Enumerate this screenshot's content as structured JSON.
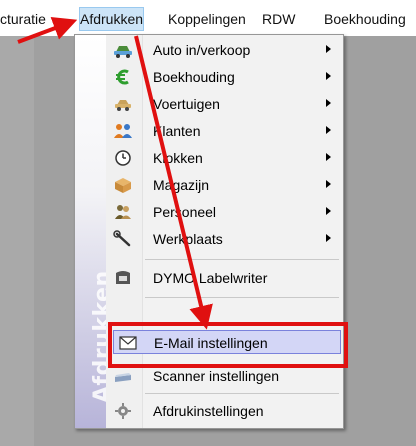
{
  "menubar": {
    "items": [
      {
        "label": "cturatie",
        "active": false
      },
      {
        "label": "Afdrukken",
        "active": true
      },
      {
        "label": "Koppelingen",
        "active": false
      },
      {
        "label": "RDW",
        "active": false
      },
      {
        "label": "Boekhouding",
        "active": false
      }
    ]
  },
  "dropdown": {
    "strip_label": "Afdrukken",
    "items": [
      {
        "label": "Auto in/verkoop",
        "icon": "car-icon",
        "submenu": true
      },
      {
        "label": "Boekhouding",
        "icon": "euro-icon",
        "submenu": true
      },
      {
        "label": "Voertuigen",
        "icon": "vehicle-icon",
        "submenu": true
      },
      {
        "label": "Klanten",
        "icon": "customers-icon",
        "submenu": true
      },
      {
        "label": "Klokken",
        "icon": "clock-icon",
        "submenu": true
      },
      {
        "label": "Magazijn",
        "icon": "box-icon",
        "submenu": true
      },
      {
        "label": "Personeel",
        "icon": "staff-icon",
        "submenu": true
      },
      {
        "label": "Werkplaats",
        "icon": "wrench-icon",
        "submenu": true
      },
      {
        "label": "DYMO Labelwriter",
        "icon": "label-printer-icon",
        "submenu": false
      },
      {
        "label": "E-Mail instellingen",
        "icon": "envelope-icon",
        "submenu": false,
        "highlighted": true
      },
      {
        "label": "Scanner instellingen",
        "icon": "scanner-icon",
        "submenu": false
      },
      {
        "label": "Afdrukinstellingen",
        "icon": "printer-settings-icon",
        "submenu": false
      }
    ]
  },
  "colors": {
    "annotation": "#e01010",
    "highlight": "#d3d6f6",
    "highlight_border": "#7a82dc",
    "euro": "#2e9e2e"
  }
}
